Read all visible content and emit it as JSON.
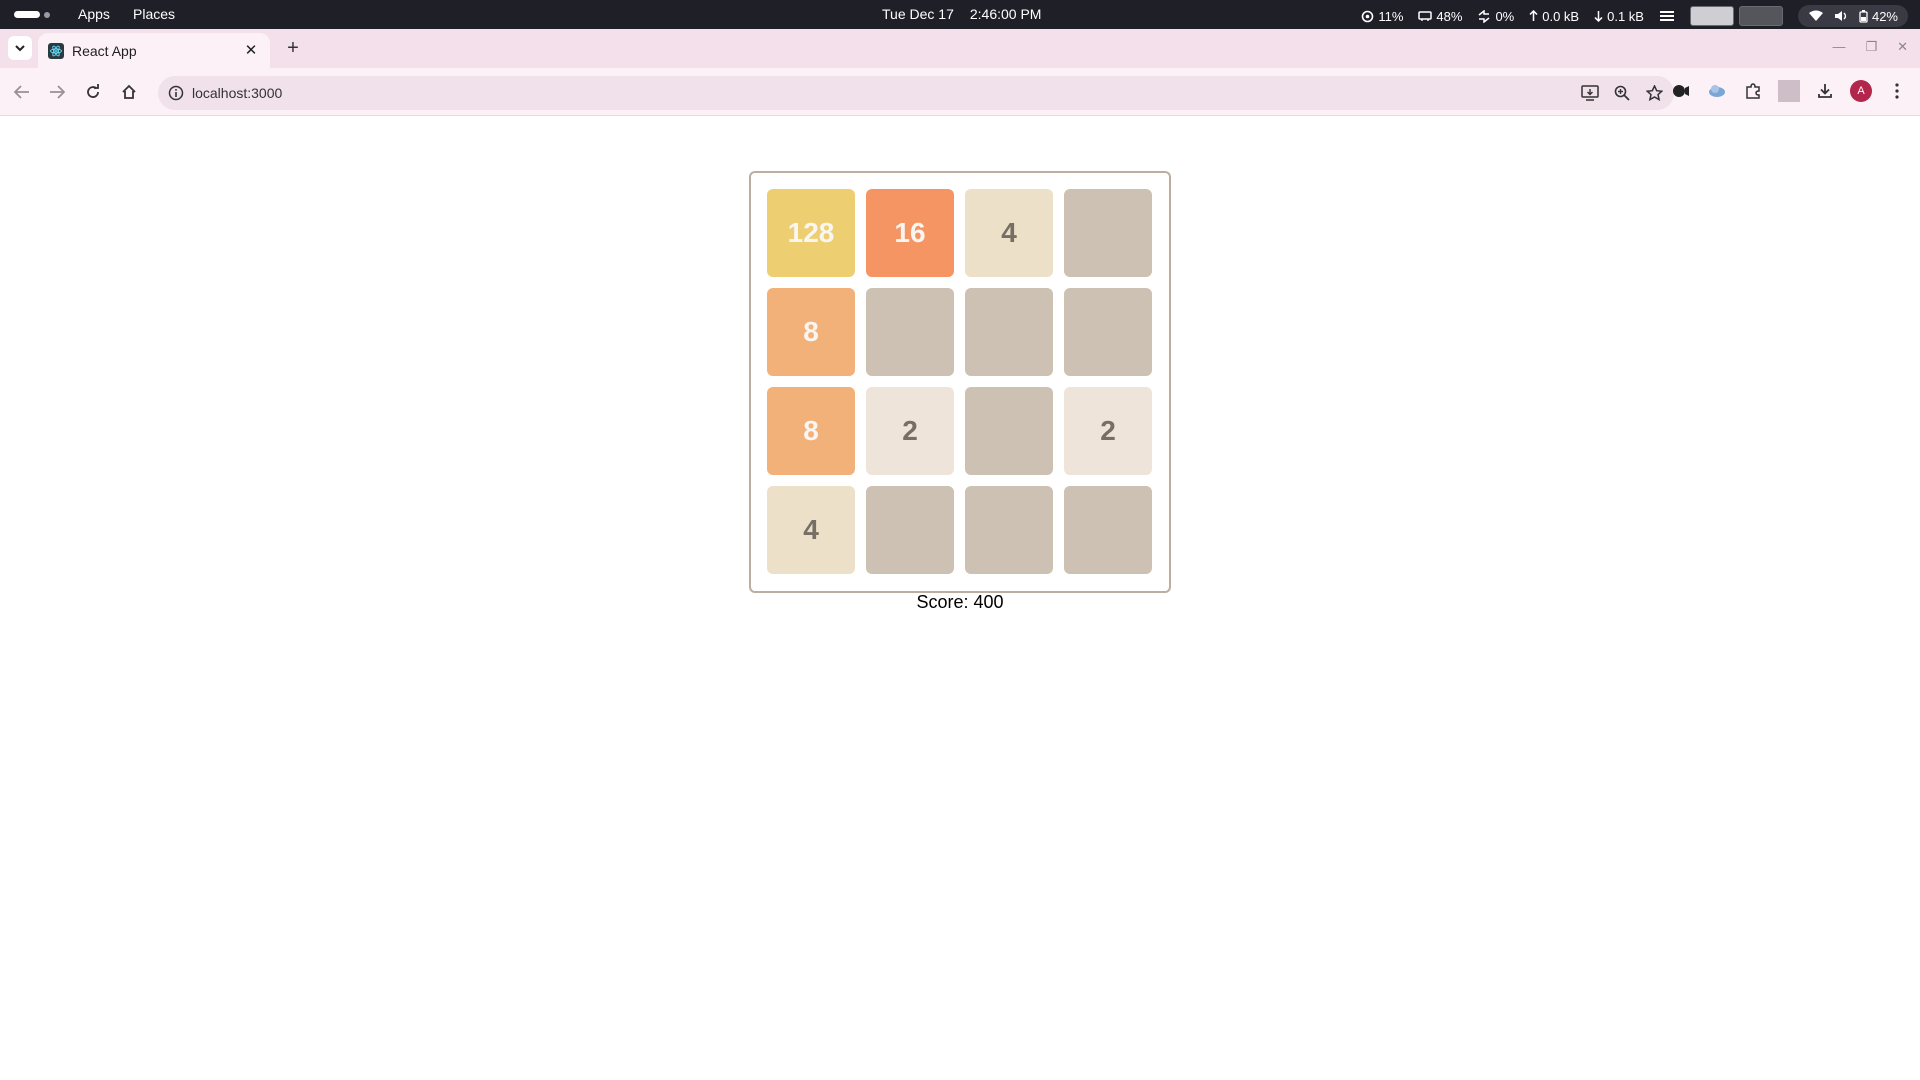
{
  "topbar": {
    "apps_label": "Apps",
    "places_label": "Places",
    "date": "Tue Dec 17",
    "time": "2:46:00 PM",
    "cpu": "11%",
    "memory": "48%",
    "swap": "0%",
    "upload": "0.0 kB",
    "download": "0.1 kB",
    "battery": "42%"
  },
  "browser": {
    "tab_title": "React App",
    "url": "localhost:3000",
    "avatar_letter": "A"
  },
  "game": {
    "score_label": "Score: 400",
    "grid": [
      [
        "128",
        "16",
        "4",
        ""
      ],
      [
        "8",
        "",
        "",
        ""
      ],
      [
        "8",
        "2",
        "",
        "2"
      ],
      [
        "4",
        "",
        "",
        ""
      ]
    ],
    "colors": {
      "empty": "#cdc1b4",
      "2": "#eee4da",
      "4": "#ede0c8",
      "8": "#f2b179",
      "16": "#f59563",
      "128": "#edcf72",
      "text_dark": "#776e65",
      "text_light": "#f9f6f2",
      "border": "#bbada0"
    }
  }
}
